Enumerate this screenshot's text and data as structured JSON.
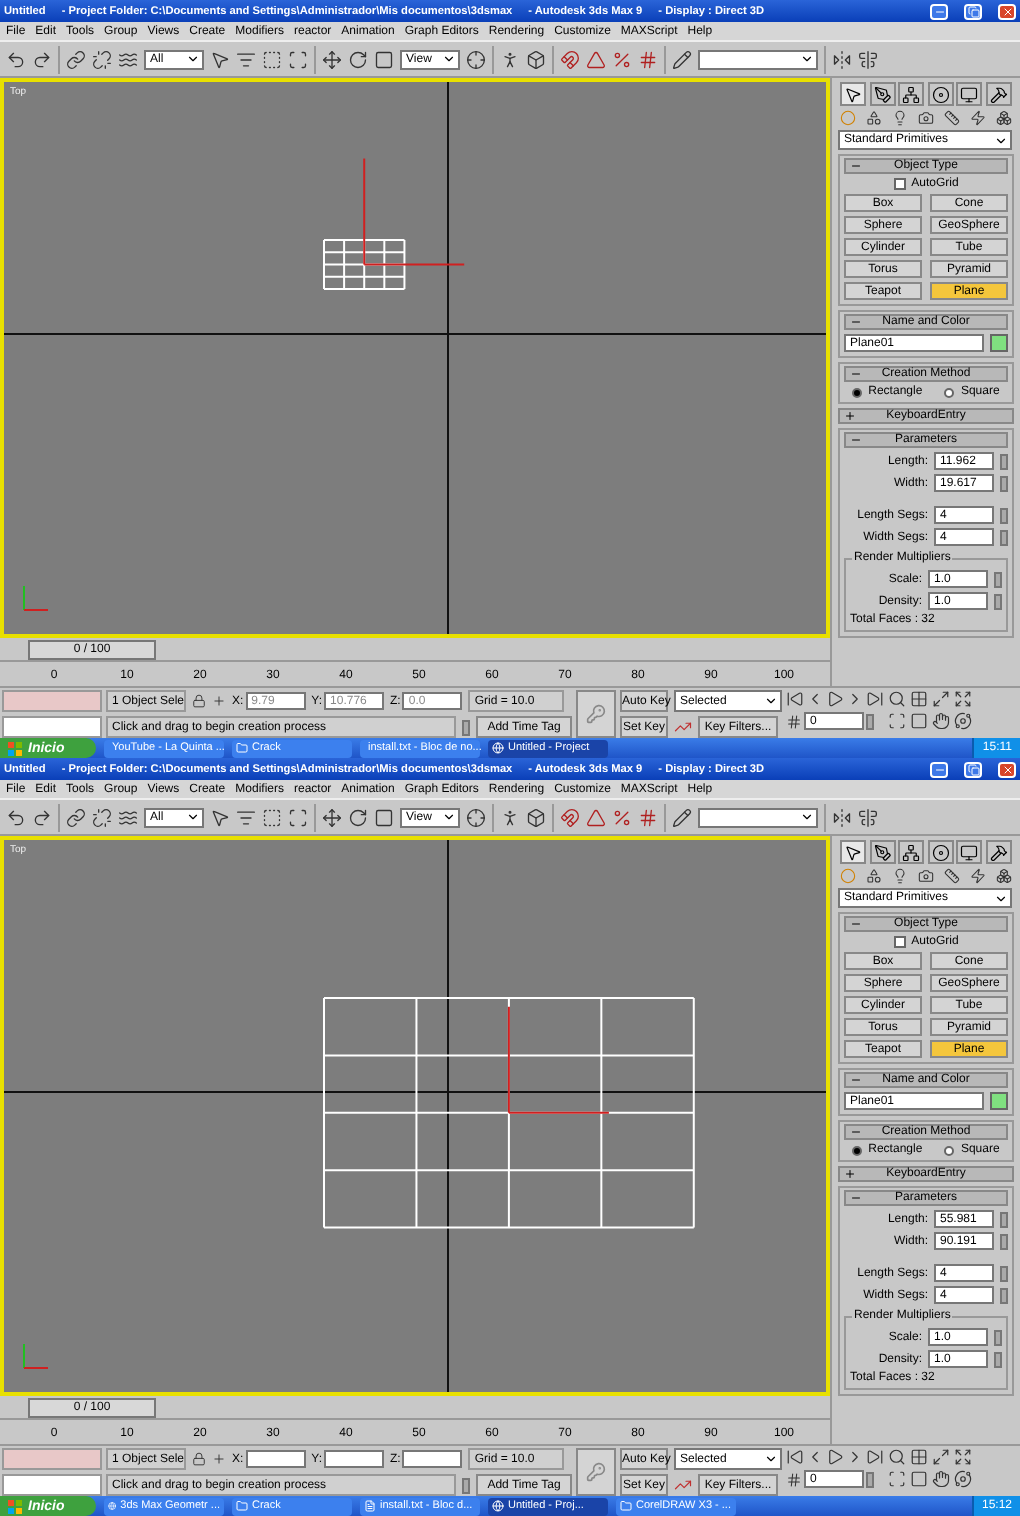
{
  "windows": [
    {
      "title_bar": {
        "document": "Untitled",
        "project": "- Project Folder: C:\\Documents and Settings\\Administrador\\Mis documentos\\3dsmax",
        "app": "- Autodesk 3ds Max 9",
        "display": "- Display : Direct 3D"
      },
      "menu": [
        "File",
        "Edit",
        "Tools",
        "Group",
        "Views",
        "Create",
        "Modifiers",
        "reactor",
        "Animation",
        "Graph Editors",
        "Rendering",
        "Customize",
        "MAXScript",
        "Help"
      ],
      "toolbar": {
        "selection_filter": "All",
        "coordinate_system": "View"
      },
      "viewport": {
        "label": "Top",
        "active": true
      },
      "command_panel": {
        "category": "Standard Primitives",
        "object_type": {
          "title": "Object Type",
          "expanded": true,
          "autogrid": {
            "label": "AutoGrid",
            "checked": false
          },
          "buttons": [
            {
              "label": "Box",
              "selected": false
            },
            {
              "label": "Cone",
              "selected": false
            },
            {
              "label": "Sphere",
              "selected": false
            },
            {
              "label": "GeoSphere",
              "selected": false
            },
            {
              "label": "Cylinder",
              "selected": false
            },
            {
              "label": "Tube",
              "selected": false
            },
            {
              "label": "Torus",
              "selected": false
            },
            {
              "label": "Pyramid",
              "selected": false
            },
            {
              "label": "Teapot",
              "selected": false
            },
            {
              "label": "Plane",
              "selected": true
            }
          ]
        },
        "name_and_color": {
          "title": "Name and Color",
          "expanded": true,
          "name": "Plane01",
          "color": "#80e080"
        },
        "creation_method": {
          "title": "Creation Method",
          "expanded": true,
          "options": [
            {
              "label": "Rectangle",
              "selected": true
            },
            {
              "label": "Square",
              "selected": false
            }
          ]
        },
        "keyboard_entry": {
          "title": "KeyboardEntry",
          "expanded": false
        },
        "parameters": {
          "title": "Parameters",
          "expanded": true,
          "fields": [
            {
              "label": "Length:",
              "value": "11.962"
            },
            {
              "label": "Width:",
              "value": "19.617"
            },
            {
              "label": "Length Segs:",
              "value": "4"
            },
            {
              "label": "Width Segs:",
              "value": "4"
            }
          ],
          "render_multipliers": {
            "title": "Render Multipliers",
            "fields": [
              {
                "label": "Scale:",
                "value": "1.0"
              },
              {
                "label": "Density:",
                "value": "1.0"
              }
            ]
          },
          "total_faces": "Total Faces : 32"
        }
      },
      "time_slider": {
        "position": "0 / 100",
        "level": 0
      },
      "ruler": [
        "0",
        "10",
        "20",
        "30",
        "40",
        "50",
        "60",
        "70",
        "80",
        "90",
        "100"
      ],
      "status": {
        "selection": "1 Object Sele",
        "coords": [
          {
            "label": "X:",
            "value": "9.79"
          },
          {
            "label": "Y:",
            "value": "10.776"
          },
          {
            "label": "Z:",
            "value": "0.0"
          }
        ],
        "grid": "Grid = 10.0",
        "prompt": "Click and drag to begin creation process",
        "add_time_tag": "Add Time Tag",
        "auto_key": "Auto Key",
        "key_mode": "Selected",
        "set_key": "Set Key",
        "key_filters": "Key Filters...",
        "frame": "0"
      },
      "taskbar": {
        "start": "Inicio",
        "tasks": [
          {
            "label": "YouTube - La Quinta ...",
            "selected": false
          },
          {
            "label": "Crack",
            "selected": false
          },
          {
            "label": "install.txt - Bloc de no...",
            "selected": false
          },
          {
            "label": "Untitled - Project",
            "selected": true
          }
        ],
        "clock": "15:11"
      }
    },
    {
      "title_bar": {
        "document": "Untitled",
        "project": "- Project Folder: C:\\Documents and Settings\\Administrador\\Mis documentos\\3dsmax",
        "app": "- Autodesk 3ds Max 9",
        "display": "- Display : Direct 3D"
      },
      "menu": [
        "File",
        "Edit",
        "Tools",
        "Group",
        "Views",
        "Create",
        "Modifiers",
        "reactor",
        "Animation",
        "Graph Editors",
        "Rendering",
        "Customize",
        "MAXScript",
        "Help"
      ],
      "toolbar": {
        "selection_filter": "All",
        "coordinate_system": "View"
      },
      "viewport": {
        "label": "Top",
        "active": true
      },
      "command_panel": {
        "category": "Standard Primitives",
        "object_type": {
          "title": "Object Type",
          "expanded": true,
          "autogrid": {
            "label": "AutoGrid",
            "checked": false
          },
          "buttons": [
            {
              "label": "Box",
              "selected": false
            },
            {
              "label": "Cone",
              "selected": false
            },
            {
              "label": "Sphere",
              "selected": false
            },
            {
              "label": "GeoSphere",
              "selected": false
            },
            {
              "label": "Cylinder",
              "selected": false
            },
            {
              "label": "Tube",
              "selected": false
            },
            {
              "label": "Torus",
              "selected": false
            },
            {
              "label": "Pyramid",
              "selected": false
            },
            {
              "label": "Teapot",
              "selected": false
            },
            {
              "label": "Plane",
              "selected": true
            }
          ]
        },
        "name_and_color": {
          "title": "Name and Color",
          "expanded": true,
          "name": "Plane01",
          "color": "#80e080"
        },
        "creation_method": {
          "title": "Creation Method",
          "expanded": true,
          "options": [
            {
              "label": "Rectangle",
              "selected": true
            },
            {
              "label": "Square",
              "selected": false
            }
          ]
        },
        "keyboard_entry": {
          "title": "KeyboardEntry",
          "expanded": false
        },
        "parameters": {
          "title": "Parameters",
          "expanded": true,
          "fields": [
            {
              "label": "Length:",
              "value": "55.981"
            },
            {
              "label": "Width:",
              "value": "90.191"
            },
            {
              "label": "Length Segs:",
              "value": "4"
            },
            {
              "label": "Width Segs:",
              "value": "4"
            }
          ],
          "render_multipliers": {
            "title": "Render Multipliers",
            "fields": [
              {
                "label": "Scale:",
                "value": "1.0"
              },
              {
                "label": "Density:",
                "value": "1.0"
              }
            ]
          },
          "total_faces": "Total Faces : 32"
        }
      },
      "time_slider": {
        "position": "0 / 100",
        "level": 0
      },
      "ruler": [
        "0",
        "10",
        "20",
        "30",
        "40",
        "50",
        "60",
        "70",
        "80",
        "90",
        "100"
      ],
      "status": {
        "selection": "1 Object Sele",
        "coords": [
          {
            "label": "X:"
          },
          {
            "label": "Y:"
          },
          {
            "label": "Z:"
          }
        ],
        "grid": "Grid = 10.0",
        "prompt": "Click and drag to begin creation process",
        "add_time_tag": "Add Time Tag",
        "auto_key": "Auto Key",
        "key_mode": "Selected",
        "set_key": "Set Key",
        "key_filters": "Key Filters...",
        "frame": "0"
      },
      "taskbar": {
        "start": "Inicio",
        "tasks": [
          {
            "label": "3ds Max Geometr ...",
            "selected": false
          },
          {
            "label": "Crack",
            "selected": false
          },
          {
            "label": "install.txt - Bloc d...",
            "selected": false
          },
          {
            "label": "Untitled - Proj...",
            "selected": true
          },
          {
            "label": "CorelDRAW X3 - ...",
            "selected": false
          }
        ],
        "clock": "15:12"
      }
    }
  ]
}
